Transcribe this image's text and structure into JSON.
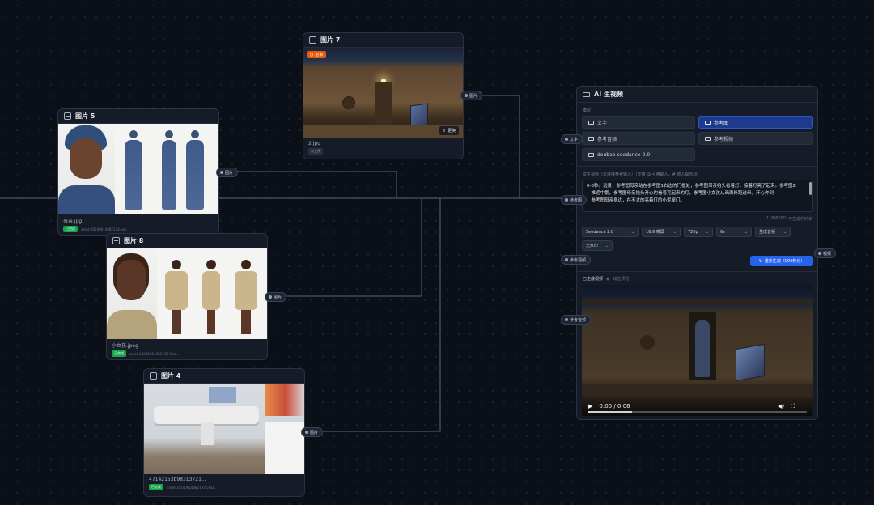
{
  "nodes": {
    "img5": {
      "title": "图片 5",
      "file": "母亲.jpg",
      "badge": "已完成",
      "meta": "asset-20240614082138-jqrc...",
      "port": "图片"
    },
    "img7": {
      "title": "图片 7",
      "file": "2.jpg",
      "badge": "未上传",
      "tag": "进审",
      "replace": "更换",
      "port": "图片"
    },
    "img8": {
      "title": "图片 8",
      "file": "小女孩.jpeg",
      "badge": "已完成",
      "meta": "asset-20240614082135-t7zq...",
      "port": "图片"
    },
    "img4": {
      "title": "图片 4",
      "file": "47142153b98313721...",
      "badge": "已完成",
      "meta": "asset-20240614082133-5t32...",
      "port": "图片"
    }
  },
  "ai": {
    "title": "AI 生视频",
    "mode_label": "模型",
    "modes": [
      "文字",
      "参考图",
      "参考音频",
      "参考视频"
    ],
    "model": "doubao-seedance-2.0",
    "prompt_label": "文生视频（未连接参考输入）（支持 @ 引用输入，# 插入提示词）",
    "prompt_text": "0-6秒。远景，参考图母亲站在参考图1右边的门框处，参考图母亲抬头看着灯，接着灯亮了起来。参考图2\n，推近中景，参考图母亲抬头开心的看着亮起来的灯，参考图小女孩从画面外跑进来，开心奔到\n，参考图母亲身边，在不太的亮着灯的小泥屋门。",
    "char_count": "116/6000",
    "char_hint": "可生成约时长",
    "options": [
      "Seedance 2.0",
      "16:9 横屏",
      "720p",
      "6s",
      "生成音频",
      "无水印"
    ],
    "generate_label": "重新生成（900积分）",
    "generated_label": "已生成视频",
    "generated_hint": "双击预览",
    "time": "0:00 / 0:06",
    "ports_in": [
      "文字",
      "参考图",
      "参考视频",
      "参考音频"
    ],
    "port_out": "视频"
  },
  "colors": {
    "accent": "#2563eb",
    "success": "#16a34a",
    "warning": "#ea580c"
  }
}
